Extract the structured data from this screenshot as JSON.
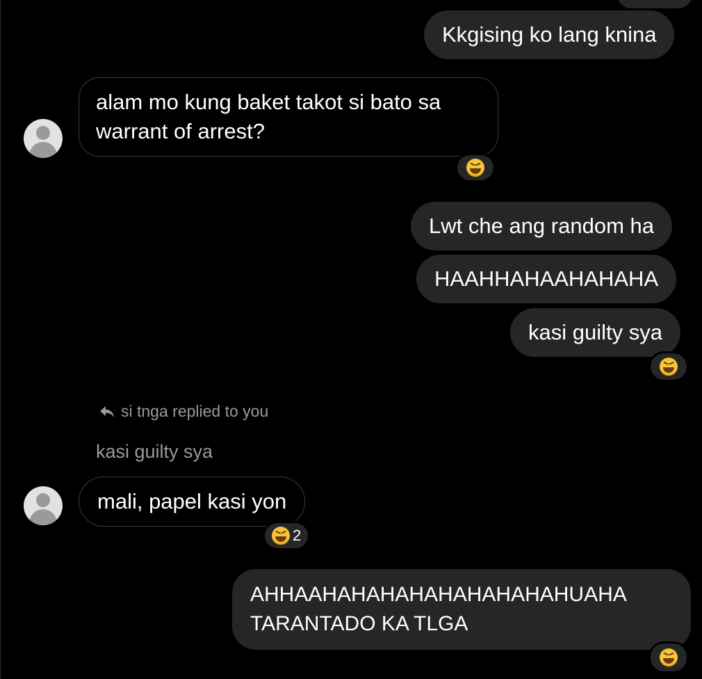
{
  "messages": {
    "m1": "Kkgising ko lang knina",
    "m2_line1": "alam mo kung baket takot si bato sa",
    "m2_line2": "warrant of arrest?",
    "m3": "Lwt che ang random ha",
    "m4": "HAAHHAHAAHAHAHA",
    "m5": "kasi guilty sya",
    "reply_header": "si tnga replied to you",
    "reply_quote": "kasi guilty sya",
    "m6": "mali, papel kasi yon",
    "m6_reaction_count": "2",
    "m7_line1": "AHHAAHAHAHAHAHAHAHAHAHUAHA",
    "m7_line2": "TARANTADO KA TLGA"
  },
  "icons": {
    "reaction": "grinning-squinting-face-emoji",
    "reply": "reply-arrow-icon",
    "avatar": "default-avatar-icon"
  },
  "colors": {
    "background": "#000000",
    "outgoing_bubble": "#262626",
    "incoming_border": "#3a3a3a",
    "muted_text": "#9a9a9a"
  }
}
